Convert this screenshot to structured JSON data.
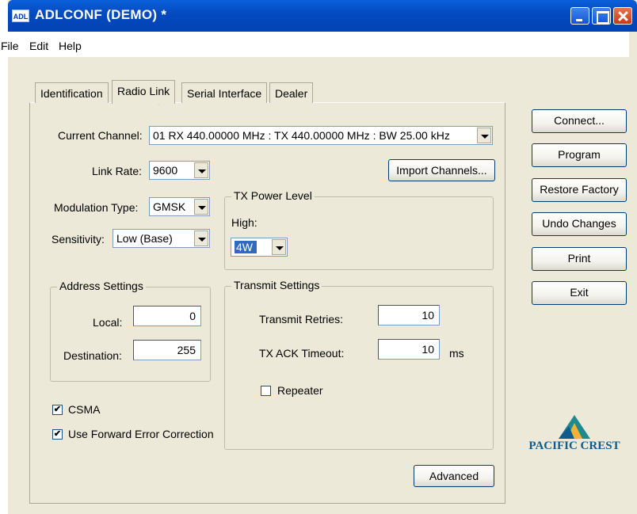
{
  "window": {
    "app_icon": "ADL",
    "title": "ADLCONF (DEMO) *"
  },
  "menu": [
    "File",
    "Edit",
    "Help"
  ],
  "tabs": [
    "Identification",
    "Radio Link",
    "Serial Interface",
    "Dealer"
  ],
  "active_tab": "Radio Link",
  "form": {
    "current_channel_label": "Current Channel:",
    "current_channel_value": "01  RX 440.00000 MHz : TX 440.00000 MHz : BW 25.00 kHz",
    "link_rate_label": "Link Rate:",
    "link_rate_value": "9600",
    "import_channels": "Import Channels...",
    "modulation_label": "Modulation Type:",
    "modulation_value": "GMSK",
    "sensitivity_label": "Sensitivity:",
    "sensitivity_value": "Low (Base)",
    "tx_power_group": "TX Power Level",
    "tx_power_high_label": "High:",
    "tx_power_value": "4W",
    "address_group": "Address Settings",
    "local_label": "Local:",
    "local_value": "0",
    "destination_label": "Destination:",
    "destination_value": "255",
    "transmit_group": "Transmit Settings",
    "retries_label": "Transmit Retries:",
    "retries_value": "10",
    "ack_label": "TX ACK Timeout:",
    "ack_value": "10",
    "ack_unit": "ms",
    "repeater_label": "Repeater",
    "repeater_checked": false,
    "csma_label": "CSMA",
    "csma_checked": true,
    "fec_label": "Use Forward Error Correction",
    "fec_checked": true,
    "advanced": "Advanced"
  },
  "side_buttons": {
    "connect": "Connect...",
    "program": "Program",
    "restore": "Restore Factory",
    "undo": "Undo Changes",
    "print": "Print",
    "exit": "Exit"
  },
  "logo": {
    "text": "PACIFIC CREST"
  },
  "colors": {
    "titlebar": "#0449c0",
    "window_bg": "#ece9d8",
    "logo": "#0e5b8c"
  }
}
